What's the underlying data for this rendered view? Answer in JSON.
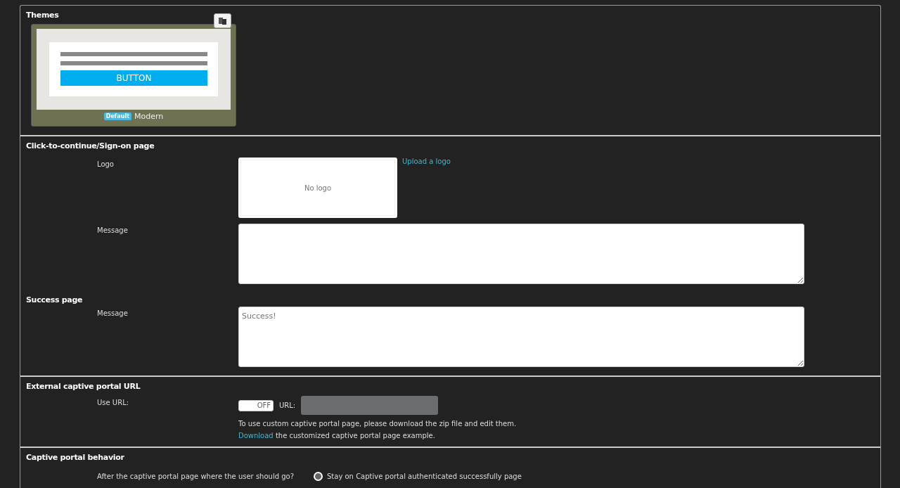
{
  "themes": {
    "title": "Themes",
    "cards": [
      {
        "badge": "Default",
        "name": "Modern",
        "preview_button": "BUTTON",
        "selected": true
      }
    ]
  },
  "sign_on": {
    "title": "Click-to-continue/Sign-on page",
    "logo_label": "Logo",
    "logo_placeholder": "No logo",
    "upload_link": "Upload a logo",
    "message_label": "Message"
  },
  "success": {
    "title": "Success page",
    "message_label": "Message",
    "message_placeholder": "Success!"
  },
  "external": {
    "title": "External captive portal URL",
    "use_url_label": "Use URL:",
    "toggle": {
      "label": "OFF",
      "on": false
    },
    "url_label": "URL:",
    "url_disabled": true,
    "note": "To use custom captive portal page, please download the zip file and edit them.",
    "download_link": "Download",
    "download_text": "the customized captive portal page example."
  },
  "behavior": {
    "title": "Captive portal behavior",
    "question": "After the captive portal page where the user should go?",
    "options": [
      {
        "label": "Stay on Captive portal authenticated successfully page",
        "selected": true
      }
    ]
  }
}
